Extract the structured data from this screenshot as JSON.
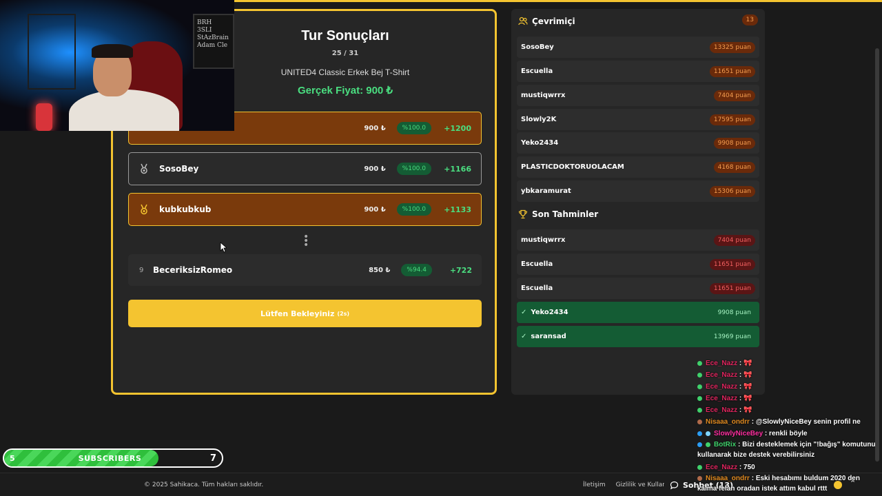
{
  "results": {
    "title": "Tur Sonuçları",
    "round": "25 / 31",
    "product": "UNITED4 Classic Erkek Bej T-Shirt",
    "real_price": "Gerçek Fiyat: 900 ₺",
    "rows": [
      {
        "name": "",
        "price": "900 ₺",
        "pct": "%100.0",
        "points": "+1200"
      },
      {
        "name": "SosoBey",
        "price": "900 ₺",
        "pct": "%100.0",
        "points": "+1166"
      },
      {
        "name": "kubkubkub",
        "price": "900 ₺",
        "pct": "%100.0",
        "points": "+1133"
      },
      {
        "rank": "9",
        "name": "BeceriksizRomeo",
        "price": "850 ₺",
        "pct": "%94.4",
        "points": "+722"
      }
    ],
    "wait_label": "Lütfen Bekleyiniz",
    "wait_timer": "(2s)"
  },
  "sidebar": {
    "online_title": "Çevrimiçi",
    "online_count": "13",
    "online": [
      {
        "name": "SosoBey",
        "score": "13325 puan"
      },
      {
        "name": "Escuella",
        "score": "11651 puan"
      },
      {
        "name": "mustiqwrrx",
        "score": "7404 puan"
      },
      {
        "name": "Slowly2K",
        "score": "17595 puan"
      },
      {
        "name": "Yeko2434",
        "score": "9908 puan"
      },
      {
        "name": "PLASTICDOKTORUOLACAM",
        "score": "4168 puan"
      },
      {
        "name": "ybkaramurat",
        "score": "15306 puan"
      }
    ],
    "guesses_title": "Son Tahminler",
    "guesses": [
      {
        "name": "mustiqwrrx",
        "score": "7404 puan",
        "correct": false
      },
      {
        "name": "Escuella",
        "score": "11651 puan",
        "correct": false
      },
      {
        "name": "Escuella",
        "score": "11651 puan",
        "correct": false
      },
      {
        "name": "Yeko2434",
        "score": "9908 puan",
        "correct": true
      },
      {
        "name": "saransad",
        "score": "13969 puan",
        "correct": true
      }
    ]
  },
  "subscribers": {
    "left": "5",
    "label": "SUBSCRIBERS",
    "right": "7",
    "progress": 0.71
  },
  "webcam": {
    "board_text": "BRH\n3SLI\nStAzBrain\nAdam Cle"
  },
  "footer": {
    "copyright": "© 2025 Sahikaca. Tüm hakları saklıdır.",
    "contact": "İletişim",
    "privacy": "Gizlilik ve Kullanım",
    "chat_label": "Sohbet (13)"
  },
  "chat": [
    {
      "user": "Ece_Nazz",
      "text": "🎀"
    },
    {
      "user": "Ece_Nazz",
      "text": "🎀"
    },
    {
      "user": "Ece_Nazz",
      "text": "🎀"
    },
    {
      "user": "Ece_Nazz",
      "text": "🎀"
    },
    {
      "user": "Ece_Nazz",
      "text": "🎀"
    },
    {
      "user": "Nisaaa_ondrr",
      "text": "@SlowlyNiceBey senin profil ne"
    },
    {
      "user": "SlowlyNiceBey",
      "text": "renkli böyle"
    },
    {
      "user": "BotRix",
      "text": "Bizi desteklemek için \"!bağış\" komutunu kullanarak bize destek verebilirsiniz"
    },
    {
      "user": "Ece_Nazz",
      "text": "750"
    },
    {
      "user": "Nisaaa_ondrr",
      "text": "Eski hesabımı buldum 2020 den kalma felan oradan istek attım kabul rttt"
    }
  ],
  "colors": {
    "accent": "#f4c430",
    "gold_row": "#7a3a0c",
    "success": "#4ade80",
    "bg": "#1a1a1a"
  }
}
